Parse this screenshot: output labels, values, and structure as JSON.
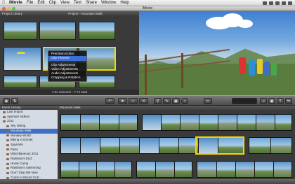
{
  "menubar": {
    "app": "iMovie",
    "items": [
      "File",
      "Edit",
      "Clip",
      "View",
      "Text",
      "Share",
      "Window",
      "Help"
    ]
  },
  "window": {
    "title": "iMovie"
  },
  "project": {
    "library_label": "Project Library",
    "title": "Project – Mountain Walk",
    "status": "2.5s selected – 7.7s total"
  },
  "context_menu": {
    "items": [
      {
        "label": "Precision Editor",
        "highlighted": false
      },
      {
        "label": "Clip Trimmer",
        "highlighted": true
      },
      {
        "label": "Clip Adjustments",
        "highlighted": false
      },
      {
        "label": "Video Adjustments",
        "highlighted": false
      },
      {
        "label": "Audio Adjustments",
        "highlighted": false
      },
      {
        "label": "Cropping & Rotation",
        "highlighted": false
      }
    ]
  },
  "event_library": {
    "header": "Event Library",
    "items": [
      {
        "label": "Last Import",
        "level": 0,
        "selected": false
      },
      {
        "label": "Aperture Videos",
        "level": 0,
        "selected": false
      },
      {
        "label": "2011",
        "level": 0,
        "selected": false
      },
      {
        "label": "Sky Diving",
        "level": 1,
        "selected": false
      },
      {
        "label": "Mountain Walk",
        "level": 1,
        "selected": true
      },
      {
        "label": "Monkey World",
        "level": 1,
        "selected": false
      },
      {
        "label": "Biking in Dorset",
        "level": 1,
        "selected": false
      },
      {
        "label": "Squirrels",
        "level": 1,
        "selected": false
      },
      {
        "label": "Paris",
        "level": 1,
        "selected": false
      },
      {
        "label": "Miscellaneous 2011",
        "level": 1,
        "selected": false
      },
      {
        "label": "Rainbow's End",
        "level": 1,
        "selected": false
      },
      {
        "label": "Horse Camp",
        "level": 1,
        "selected": false
      },
      {
        "label": "Rainbow's Swimming",
        "level": 1,
        "selected": false
      },
      {
        "label": "Don't Stop Me Now",
        "level": 1,
        "selected": false
      },
      {
        "label": "Come to Mount Cutr...",
        "level": 1,
        "selected": false
      }
    ]
  },
  "event_browser": {
    "header": "Mountain Walk"
  },
  "colors": {
    "selection_yellow": "#f2d800",
    "selection_blue": "#3f6fc9",
    "menu_highlight": "#3a6fd8"
  }
}
